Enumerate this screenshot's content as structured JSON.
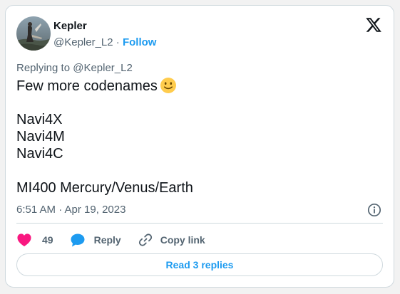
{
  "author": {
    "name": "Kepler",
    "handle": "@Kepler_L2",
    "separator": "·",
    "follow_label": "Follow"
  },
  "replying_to": "Replying to @Kepler_L2",
  "body": {
    "line1": "Few more codenames",
    "line1_emoji": "slightly-smiling-face-emoji",
    "line2": "Navi4X",
    "line3": "Navi4M",
    "line4": "Navi4C",
    "line5": "MI400 Mercury/Venus/Earth"
  },
  "timestamp": "6:51 AM · Apr 19, 2023",
  "actions": {
    "like_count": "49",
    "reply_label": "Reply",
    "copy_link_label": "Copy link"
  },
  "read_replies_label": "Read 3 replies",
  "icons": {
    "logo": "x-logo-icon",
    "info": "info-icon",
    "like": "heart-icon",
    "reply": "reply-bubble-icon",
    "copy_link": "link-icon"
  },
  "colors": {
    "accent": "#1d9bf0",
    "like": "#f91880",
    "secondary_text": "#536471",
    "primary_text": "#0f1419",
    "border": "#cfd9de"
  }
}
